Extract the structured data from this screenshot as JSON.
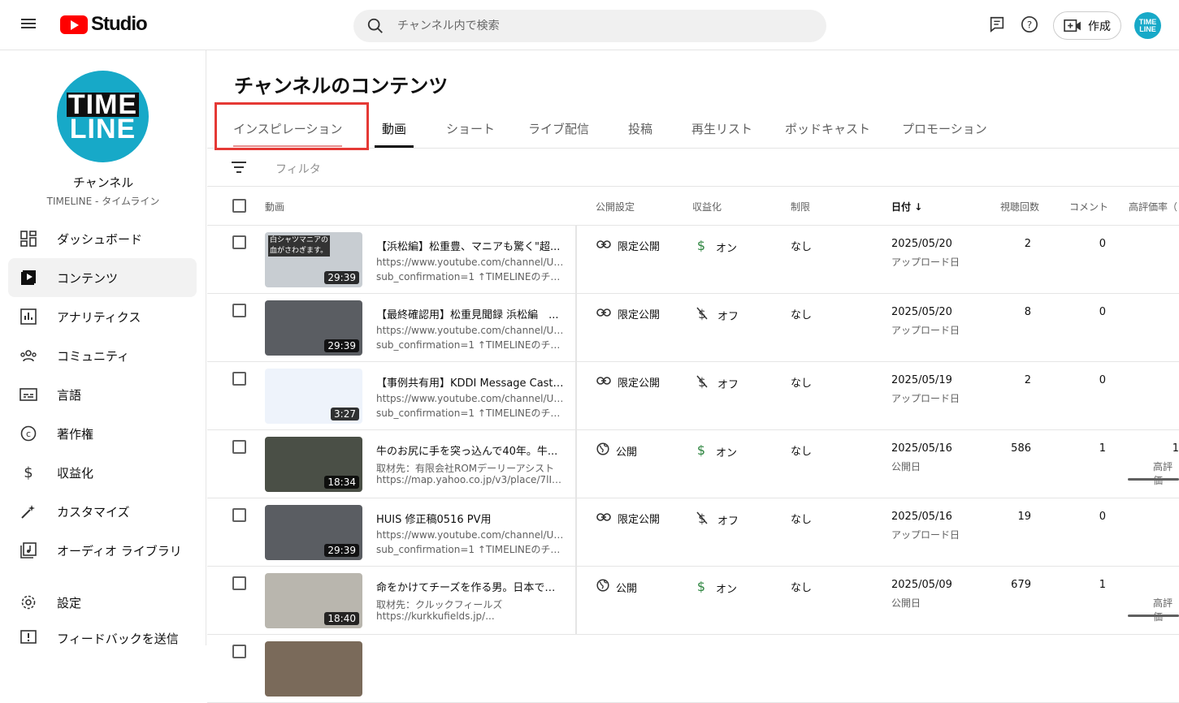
{
  "topbar": {
    "logo_text": "Studio",
    "search_placeholder": "チャンネル内で検索",
    "create_label": "作成",
    "avatar_text_1": "TIME",
    "avatar_text_2": "LINE"
  },
  "sidebar": {
    "channel_avatar_1": "TIME",
    "channel_avatar_2": "LINE",
    "channel_title": "チャンネル",
    "channel_name": "TIMELINE - タイムライン",
    "items": [
      {
        "label": "ダッシュボード",
        "icon": "dashboard-icon"
      },
      {
        "label": "コンテンツ",
        "icon": "content-icon",
        "active": true
      },
      {
        "label": "アナリティクス",
        "icon": "analytics-icon"
      },
      {
        "label": "コミュニティ",
        "icon": "community-icon"
      },
      {
        "label": "言語",
        "icon": "subtitles-icon"
      },
      {
        "label": "著作権",
        "icon": "copyright-icon"
      },
      {
        "label": "収益化",
        "icon": "dollar-icon"
      },
      {
        "label": "カスタマイズ",
        "icon": "magic-wand-icon"
      },
      {
        "label": "オーディオ ライブラリ",
        "icon": "audio-library-icon"
      }
    ],
    "bottom_items": [
      {
        "label": "設定",
        "icon": "gear-icon"
      },
      {
        "label": "フィードバックを送信",
        "icon": "feedback-icon"
      }
    ]
  },
  "main": {
    "page_title": "チャンネルのコンテンツ",
    "tabs": [
      "インスピレーション",
      "動画",
      "ショート",
      "ライブ配信",
      "投稿",
      "再生リスト",
      "ポッドキャスト",
      "プロモーション"
    ],
    "filter_label": "フィルタ",
    "columns": {
      "video": "動画",
      "visibility": "公開設定",
      "monetization": "収益化",
      "restrictions": "制限",
      "date": "日付",
      "views": "視聴回数",
      "comments": "コメント",
      "likes": "高評価率（"
    },
    "rows": [
      {
        "duration": "29:39",
        "title": "【浜松編】松重豊、マニアも驚く\"超...",
        "desc1": "https://www.youtube.com/channel/UCYPY",
        "desc2": "sub_confirmation=1 ↑TIMELINEのチャ...",
        "visibility": "限定公開",
        "vis_icon": "link-icon",
        "monetization": "オン",
        "mon_on": true,
        "restrictions": "なし",
        "date": "2025/05/20",
        "date_sub": "アップロード日",
        "views": "2",
        "comments": "0",
        "thumb_text": "白シャツマニアの\n血がさわぎます。",
        "thumb_bg": "#c8cdd2"
      },
      {
        "duration": "29:39",
        "title": "【最終確認用】松重見聞録 浜松編　...",
        "desc1": "https://www.youtube.com/channel/UCYPY",
        "desc2": "sub_confirmation=1 ↑TIMELINEのチャ...",
        "visibility": "限定公開",
        "vis_icon": "link-icon",
        "monetization": "オフ",
        "mon_on": false,
        "restrictions": "なし",
        "date": "2025/05/20",
        "date_sub": "アップロード日",
        "views": "8",
        "comments": "0",
        "thumb_text": "",
        "thumb_bg": "#5a5d62"
      },
      {
        "duration": "3:27",
        "title": "【事例共有用】KDDI Message Cast R...",
        "desc1": "https://www.youtube.com/channel/UCYPY",
        "desc2": "sub_confirmation=1 ↑TIMELINEのチャ...",
        "visibility": "限定公開",
        "vis_icon": "link-icon",
        "monetization": "オフ",
        "mon_on": false,
        "restrictions": "なし",
        "date": "2025/05/19",
        "date_sub": "アップロード日",
        "views": "2",
        "comments": "0",
        "thumb_text": "",
        "thumb_bg": "#eef3fb"
      },
      {
        "duration": "18:34",
        "title": "牛のお尻に手を突っ込んで40年。牛...",
        "desc1": "取材先：有限会社ROMデーリーアシスト",
        "desc2": "https://map.yahoo.co.jp/v3/place/7lInS...",
        "visibility": "公開",
        "vis_icon": "globe-icon",
        "monetization": "オン",
        "mon_on": true,
        "restrictions": "なし",
        "date": "2025/05/16",
        "date_sub": "公開日",
        "views": "586",
        "comments": "1",
        "likes": "1",
        "likes_sub": "高評価",
        "thumb_text": "",
        "thumb_bg": "#4a4f46"
      },
      {
        "duration": "29:39",
        "title": "HUIS 修正稿0516 PV用",
        "desc1": "https://www.youtube.com/channel/UCYPY",
        "desc2": "sub_confirmation=1 ↑TIMELINEのチャ...",
        "visibility": "限定公開",
        "vis_icon": "link-icon",
        "monetization": "オフ",
        "mon_on": false,
        "restrictions": "なし",
        "date": "2025/05/16",
        "date_sub": "アップロード日",
        "views": "19",
        "comments": "0",
        "thumb_text": "",
        "thumb_bg": "#5a5d62"
      },
      {
        "duration": "18:40",
        "title": "命をかけてチーズを作る男。日本で唯...",
        "desc1": "取材先：クルックフィールズ",
        "desc2": "https://kurkkufields.jp/...",
        "visibility": "公開",
        "vis_icon": "globe-icon",
        "monetization": "オン",
        "mon_on": true,
        "restrictions": "なし",
        "date": "2025/05/09",
        "date_sub": "公開日",
        "views": "679",
        "comments": "1",
        "likes": "",
        "likes_sub": "高評価",
        "thumb_text": "",
        "thumb_bg": "#b9b6ae"
      }
    ]
  }
}
